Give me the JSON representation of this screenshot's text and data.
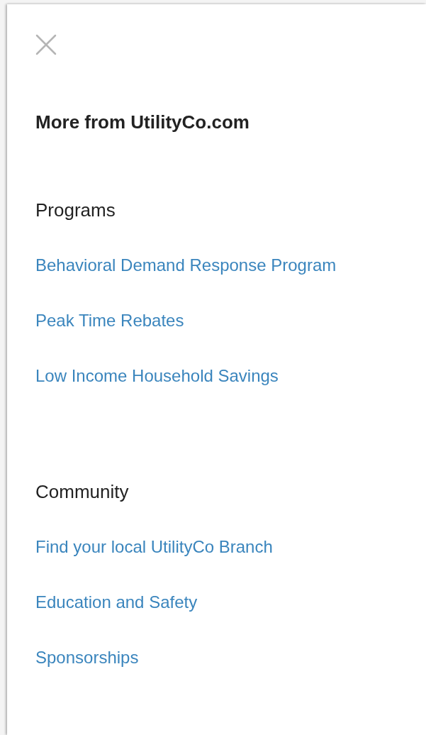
{
  "panel": {
    "title": "More from UtilityCo.com",
    "sections": [
      {
        "heading": "Programs",
        "links": [
          "Behavioral Demand Response Program",
          "Peak Time Rebates",
          "Low Income Household Savings"
        ]
      },
      {
        "heading": "Community",
        "links": [
          "Find your local UtilityCo Branch",
          "Education and Safety",
          "Sponsorships"
        ]
      }
    ]
  }
}
